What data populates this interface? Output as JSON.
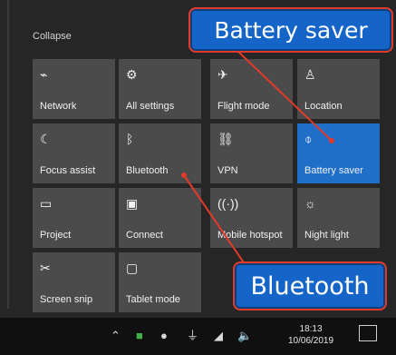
{
  "header": {
    "collapse_label": "Collapse"
  },
  "tiles": [
    {
      "label": "Network",
      "icon": "network-icon",
      "glyph": "⌁"
    },
    {
      "label": "All settings",
      "icon": "gear-icon",
      "glyph": "⚙"
    },
    {
      "label": "Flight mode",
      "icon": "airplane-icon",
      "glyph": "✈"
    },
    {
      "label": "Location",
      "icon": "location-icon",
      "glyph": "♙"
    },
    {
      "label": "Focus assist",
      "icon": "moon-icon",
      "glyph": "☾"
    },
    {
      "label": "Bluetooth",
      "icon": "bluetooth-icon",
      "glyph": "ᛒ"
    },
    {
      "label": "VPN",
      "icon": "vpn-icon",
      "glyph": "⛓"
    },
    {
      "label": "Battery saver",
      "icon": "battery-saver-icon",
      "glyph": "⌽",
      "active": true
    },
    {
      "label": "Project",
      "icon": "project-icon",
      "glyph": "▭"
    },
    {
      "label": "Connect",
      "icon": "connect-icon",
      "glyph": "▣"
    },
    {
      "label": "Mobile hotspot",
      "icon": "hotspot-icon",
      "glyph": "((·))"
    },
    {
      "label": "Night light",
      "icon": "sun-icon",
      "glyph": "☼"
    },
    {
      "label": "Screen snip",
      "icon": "scissors-icon",
      "glyph": "✂"
    },
    {
      "label": "Tablet mode",
      "icon": "tablet-icon",
      "glyph": "▢"
    }
  ],
  "callouts": {
    "battery": "Battery saver",
    "bluetooth": "Bluetooth"
  },
  "taskbar": {
    "time": "18:13",
    "date": "10/06/2019"
  },
  "colors": {
    "active_tile": "#1f6fc9",
    "tile": "#4b4b4b",
    "callout": "#1565c8",
    "callout_border": "#e23a2a"
  }
}
